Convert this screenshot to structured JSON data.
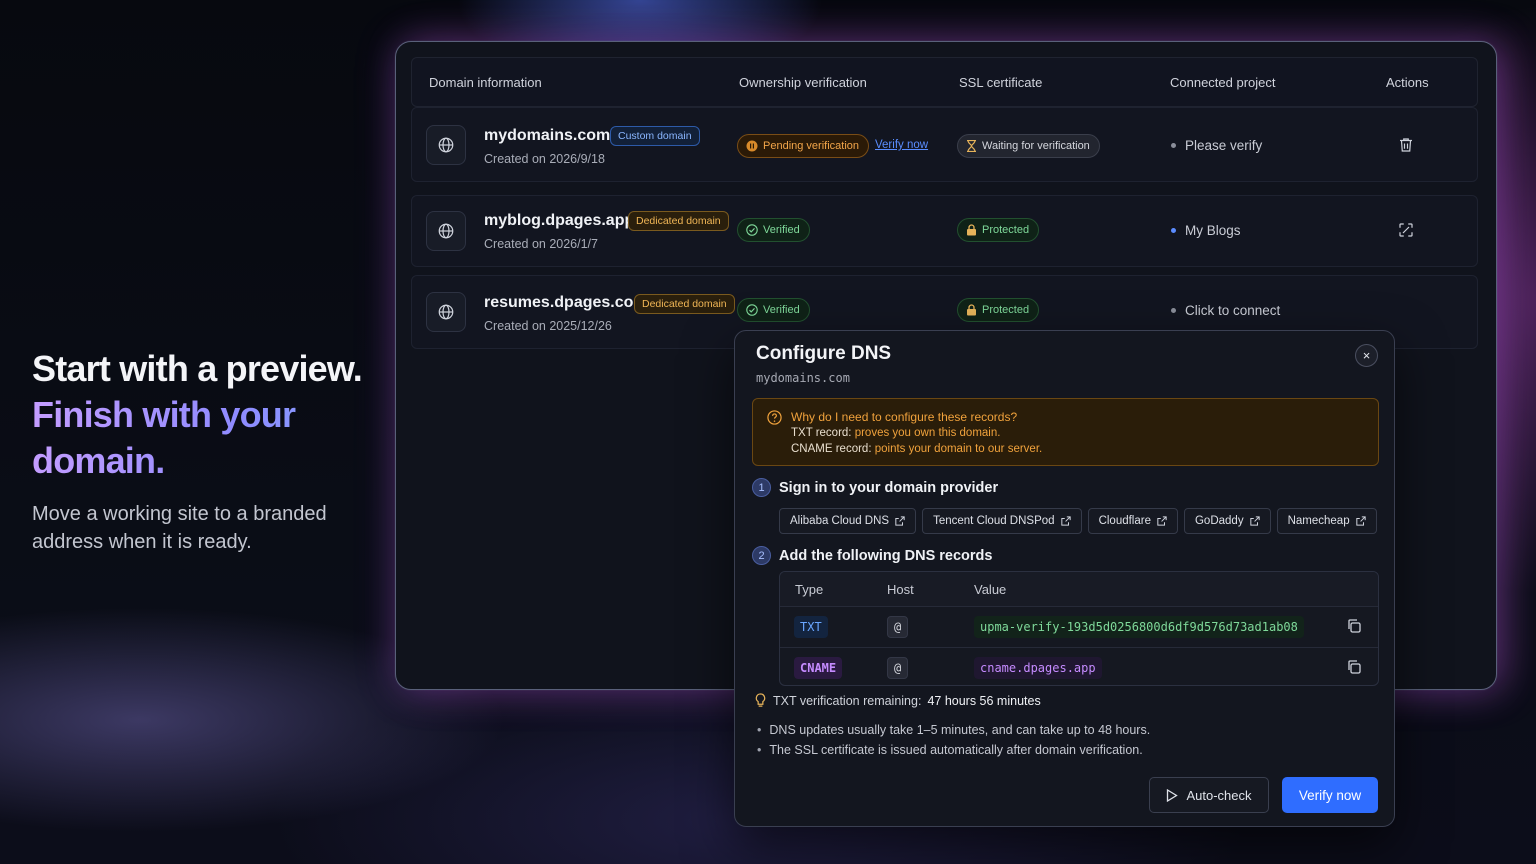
{
  "hero": {
    "line1": "Start with a preview.",
    "line2": "Finish with your domain.",
    "body": "Move a working site to a branded address when it is ready."
  },
  "table": {
    "headers": {
      "domain": "Domain information",
      "ownership": "Ownership verification",
      "ssl": "SSL certificate",
      "project": "Connected project",
      "actions": "Actions"
    },
    "rows": [
      {
        "domain": "mydomains.com",
        "tag": "Custom domain",
        "created": "Created on 2026/9/18",
        "ownership": "Pending verification",
        "verify_link": "Verify now",
        "ssl": "Waiting for verification",
        "project": "Please verify",
        "action_icon": "trash-icon"
      },
      {
        "domain": "myblog.dpages.app",
        "tag": "Dedicated domain",
        "created": "Created on 2026/1/7",
        "ownership": "Verified",
        "ssl": "Protected",
        "project": "My Blogs",
        "action_icon": "unlink-icon"
      },
      {
        "domain": "resumes.dpages.com",
        "tag": "Dedicated domain",
        "created": "Created on 2025/12/26",
        "ownership": "Verified",
        "ssl": "Protected",
        "project": "Click to connect"
      }
    ]
  },
  "modal": {
    "title": "Configure DNS",
    "domain": "mydomains.com",
    "close_label": "×",
    "notice": {
      "question": "Why do I need to configure these records?",
      "txt_label": "TXT record:",
      "txt_desc": "proves you own this domain.",
      "cname_label": "CNAME record:",
      "cname_desc": "points your domain to our server."
    },
    "step1": {
      "num": "1",
      "title": "Sign in to your domain provider"
    },
    "providers": [
      "Alibaba Cloud DNS",
      "Tencent Cloud DNSPod",
      "Cloudflare",
      "GoDaddy",
      "Namecheap"
    ],
    "step2": {
      "num": "2",
      "title": "Add the following DNS records"
    },
    "dns_headers": {
      "type": "Type",
      "host": "Host",
      "value": "Value"
    },
    "records": [
      {
        "type": "TXT",
        "host": "@",
        "value": "upma-verify-193d5d0256800d6df9d576d73ad1ab08"
      },
      {
        "type": "CNAME",
        "host": "@",
        "value": "cname.dpages.app"
      }
    ],
    "remaining_label": "TXT verification remaining:",
    "remaining_value": "47 hours 56 minutes",
    "notes": [
      "DNS updates usually take 1–5 minutes, and can take up to 48 hours.",
      "The SSL certificate is issued automatically after domain verification."
    ],
    "auto_check_label": "Auto-check",
    "verify_label": "Verify now"
  },
  "colors": {
    "accent": "#2f6dff",
    "pending": "#f3a64a",
    "verified": "#7fd99a",
    "frame_border": "#59607a"
  }
}
